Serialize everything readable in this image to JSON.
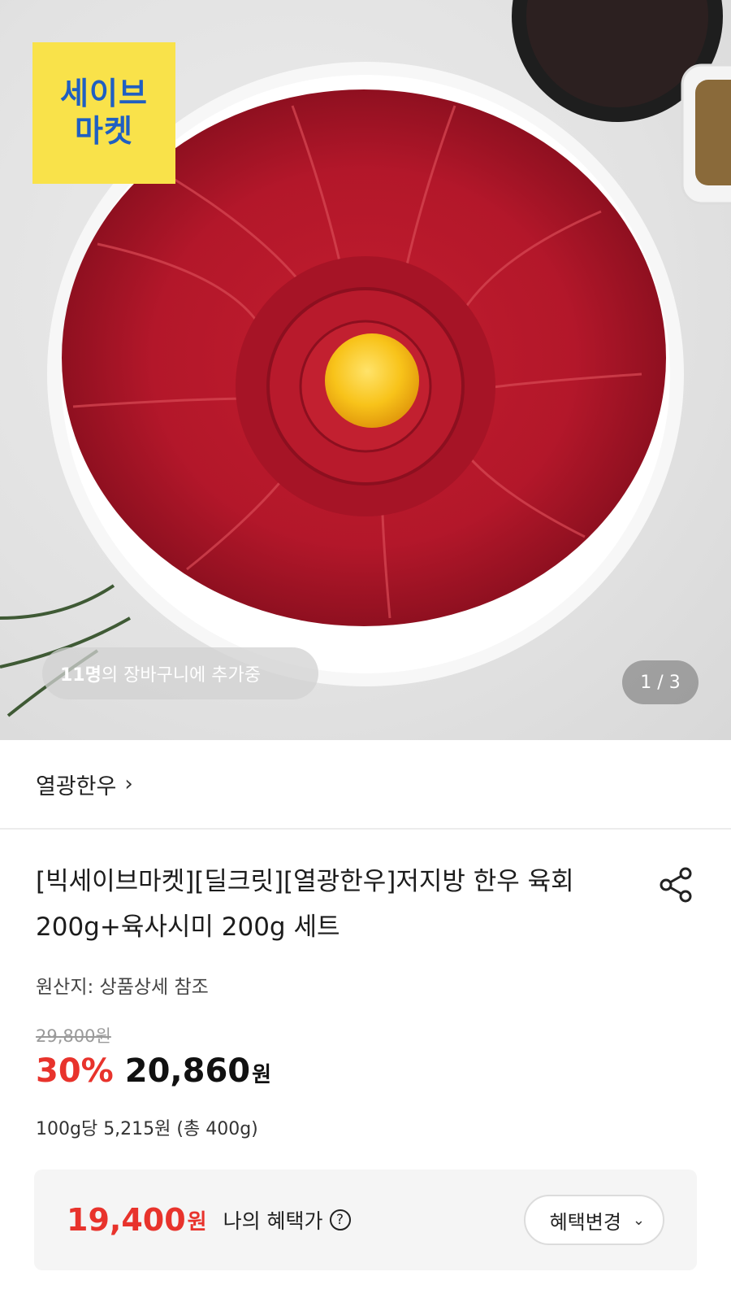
{
  "hero": {
    "badge_line1": "세이브",
    "badge_line2": "마켓",
    "cart_count": "11명",
    "cart_text": "의 장바구니에 추가중",
    "page_indicator": "1 / 3"
  },
  "seller": {
    "name": "열광한우"
  },
  "product": {
    "title": "[빅세이브마켓][딜크릿][열광한우]저지방 한우 육회 200g+육사시미 200g 세트",
    "origin": "원산지: 상품상세 참조",
    "original_price": "29,800원",
    "discount": "30%",
    "price": "20,860",
    "currency": "원",
    "unit_price": "100g당 5,215원 (총 400g)"
  },
  "benefit": {
    "price": "19,400",
    "currency": "원",
    "label": "나의 혜택가",
    "help": "?",
    "change_button": "혜택변경"
  },
  "colors": {
    "accent_red": "#e8332c",
    "badge_yellow": "#f9e24a",
    "badge_blue": "#1f5fc2"
  }
}
